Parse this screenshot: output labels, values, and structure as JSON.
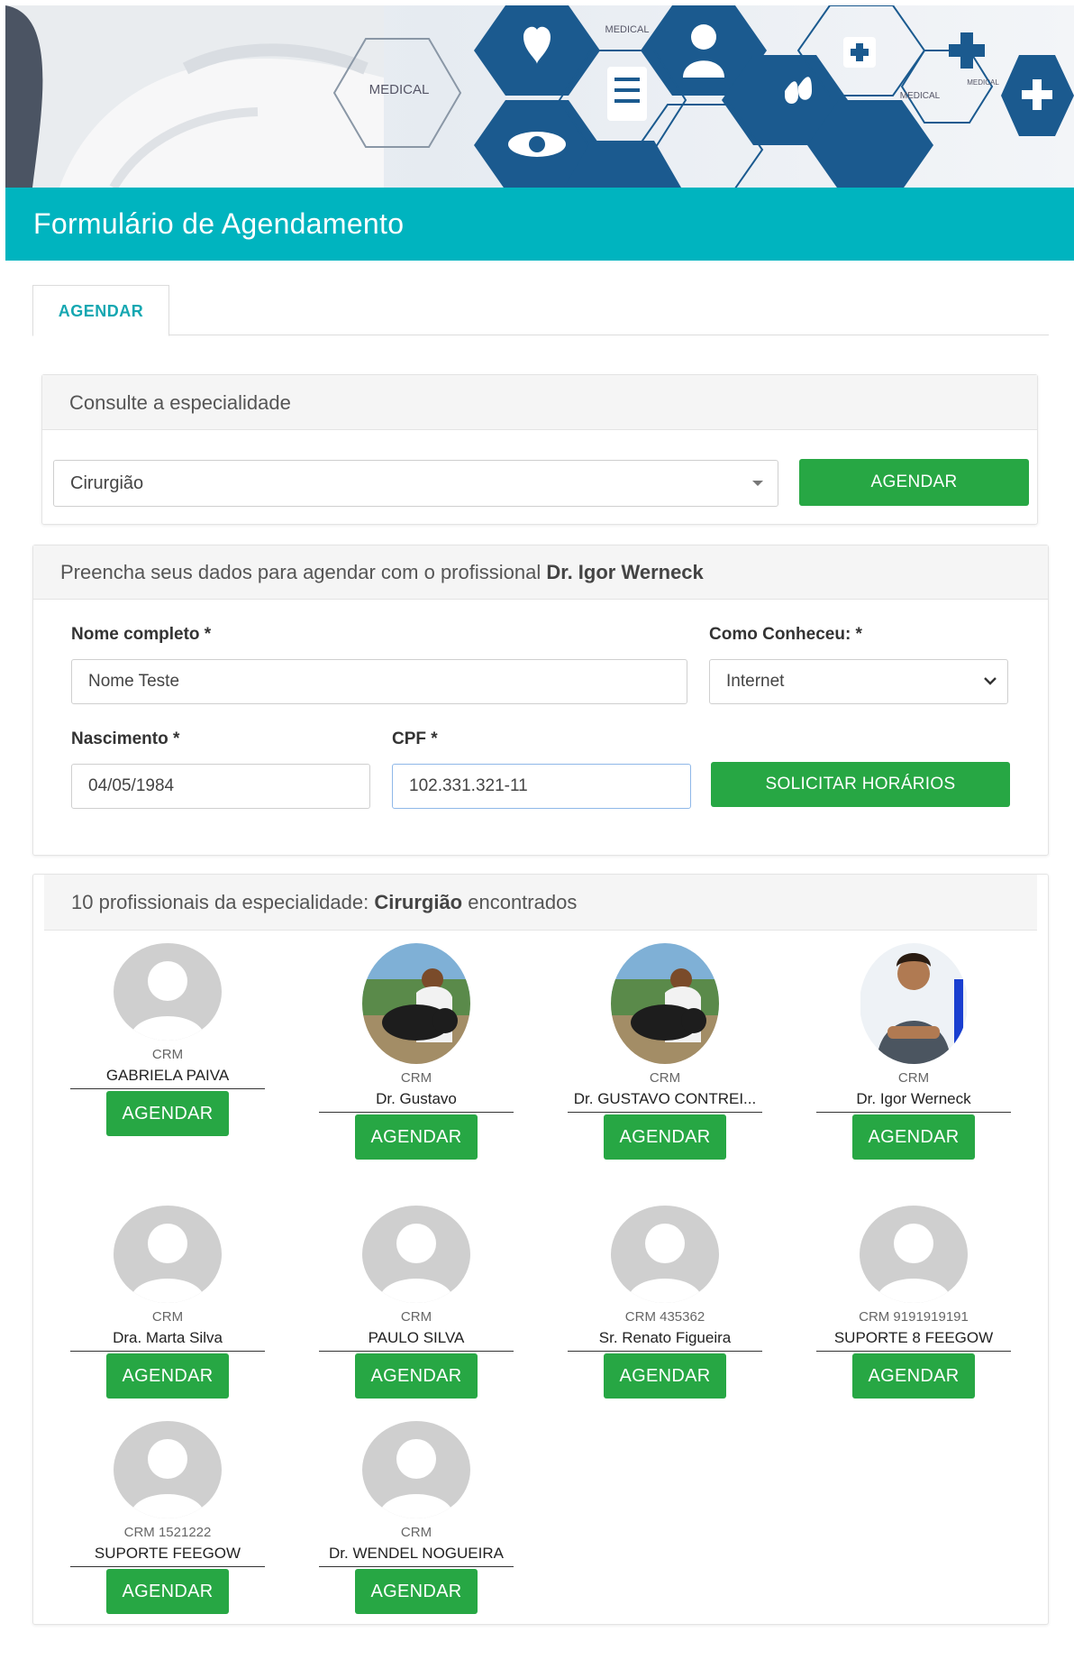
{
  "header": {
    "title": "Formulário de Agendamento"
  },
  "banner": {
    "labels": [
      "MEDICAL",
      "MEDICAL",
      "MEDICAL",
      "MEDICAL"
    ]
  },
  "tabs": [
    {
      "label": "AGENDAR"
    }
  ],
  "specialty_panel": {
    "title": "Consulte a especialidade",
    "selected": "Cirurgião",
    "button_label": "AGENDAR"
  },
  "form_panel": {
    "title_prefix": "Preencha seus dados para agendar com o profissional ",
    "professional": "Dr. Igor Werneck",
    "name_label": "Nome completo *",
    "name_value": "Nome Teste",
    "source_label": "Como Conheceu: *",
    "source_value": "Internet",
    "birth_label": "Nascimento *",
    "birth_value": "04/05/1984",
    "cpf_label": "CPF *",
    "cpf_value": "102.331.321-11",
    "button_label": "SOLICITAR HORÁRIOS"
  },
  "results_panel": {
    "title_prefix": "10 profissionais da especialidade: ",
    "specialty": "Cirurgião",
    "title_suffix": " encontrados",
    "button_label": "AGENDAR",
    "professionals": [
      {
        "crm": "CRM",
        "name": "GABRIELA PAIVA",
        "photo": "placeholder-avatar"
      },
      {
        "crm": "CRM",
        "name": "Dr. Gustavo",
        "photo": "photo-man-with-dog"
      },
      {
        "crm": "CRM",
        "name": "Dr. GUSTAVO CONTREI...",
        "photo": "photo-man-with-dog"
      },
      {
        "crm": "CRM",
        "name": "Dr. Igor Werneck",
        "photo": "photo-man-in-scrubs"
      },
      {
        "crm": "CRM",
        "name": "Dra. Marta Silva",
        "photo": "placeholder-avatar"
      },
      {
        "crm": "CRM",
        "name": "PAULO SILVA",
        "photo": "placeholder-avatar"
      },
      {
        "crm": "CRM 435362",
        "name": "Sr. Renato Figueira",
        "photo": "placeholder-avatar"
      },
      {
        "crm": "CRM 9191919191",
        "name": "SUPORTE 8 FEEGOW",
        "photo": "placeholder-avatar"
      },
      {
        "crm": "CRM 1521222",
        "name": "SUPORTE FEEGOW",
        "photo": "placeholder-avatar"
      },
      {
        "crm": "CRM",
        "name": "Dr. WENDEL NOGUEIRA",
        "photo": "placeholder-avatar"
      }
    ]
  },
  "colors": {
    "teal": "#00b4bf",
    "green": "#27a744",
    "hex_blue": "#1b5a8f"
  }
}
